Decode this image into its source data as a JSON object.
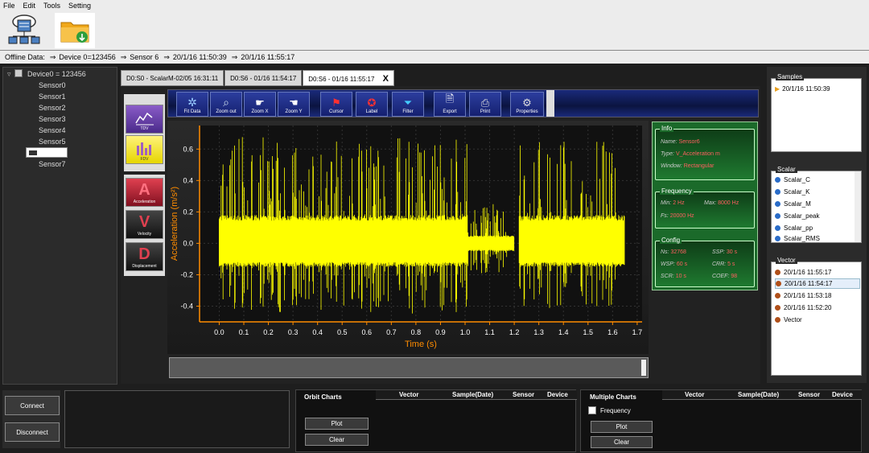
{
  "menu": [
    "File",
    "Edit",
    "Tools",
    "Setting"
  ],
  "info_bar": {
    "label": "Offline Data:",
    "device": "Device 0=123456",
    "sensor": "Sensor 6",
    "start": "20/1/16 11:50:39",
    "end": "20/1/16 11:55:17",
    "arrow": "⇒"
  },
  "tree": {
    "root": "Device0 = 123456",
    "sensors": [
      "Sensor0",
      "Sensor1",
      "Sensor2",
      "Sensor3",
      "Sensor4",
      "Sensor5",
      "",
      "Sensor7"
    ]
  },
  "tabs": [
    {
      "label": "D0:S0 - ScalarM-02/05 16:31:11"
    },
    {
      "label": "D0:S6 - 01/16 11:54:17"
    },
    {
      "label": "D0:S6 - 01/16 11:55:17",
      "close": "X"
    }
  ],
  "left_tools": [
    "TDV",
    "FDV",
    "Acceleration",
    "Velocity",
    "Displacement"
  ],
  "left_tools_glyphs": {
    "a": "A",
    "v": "V",
    "d": "D"
  },
  "toolbar": [
    "Fit Data",
    "Zoom out",
    "Zoom X",
    "Zoom Y",
    "Cursor",
    "Label",
    "Filter",
    "Export",
    "Print",
    "Properties"
  ],
  "info": {
    "title": "Info",
    "name_k": "Name:",
    "name_v": "Sensor6",
    "type_k": "Type:",
    "type_v": "V_Acceleration m",
    "window_k": "Window:",
    "window_v": "Rectangular"
  },
  "frequency": {
    "title": "Frequency",
    "min_k": "Min:",
    "min_v": "2 Hz",
    "max_k": "Max:",
    "max_v": "8000 Hz",
    "fs_k": "Fs:",
    "fs_v": "20000 Hz"
  },
  "config": {
    "title": "Config",
    "ns_k": "Ns:",
    "ns_v": "32768",
    "ssp_k": "SSP:",
    "ssp_v": "30 s",
    "wsp_k": "WSP:",
    "wsp_v": "60 s",
    "crr_k": "CRR:",
    "crr_v": "5 s",
    "scr_k": "SCR:",
    "scr_v": "10 s",
    "coef_k": "COEF:",
    "coef_v": "98"
  },
  "samples": {
    "title": "Samples",
    "items": [
      "20/1/16 11:50:39"
    ]
  },
  "scalar": {
    "title": "Scalar",
    "items": [
      "Scalar_C",
      "Scalar_K",
      "Scalar_M",
      "Scalar_peak",
      "Scalar_pp",
      "Scalar_RMS"
    ]
  },
  "vector": {
    "title": "Vector",
    "items": [
      "20/1/16 11:55:17",
      "20/1/16 11:54:17",
      "20/1/16 11:53:18",
      "20/1/16 11:52:20",
      "Vector"
    ]
  },
  "bottom": {
    "connect": "Connect",
    "disconnect": "Disconnect",
    "orbit_title": "Orbit Charts",
    "orbit_cols": [
      "Vector",
      "Sample(Date)",
      "Sensor",
      "Device"
    ],
    "orbit_plot": "Plot",
    "orbit_clear": "Clear",
    "multi_title": "Multiple Charts",
    "multi_cols": [
      "Vector",
      "Sample(Date)",
      "Sensor",
      "Device"
    ],
    "frequency": "Frequency",
    "multi_plot": "Plot",
    "multi_clear": "Clear"
  },
  "colors": {
    "signal": "#ffff00",
    "axis": "#ff8c00",
    "green_panel": "#1b6a2a",
    "toolbar": "#152070"
  },
  "chart_data": {
    "type": "line",
    "xlabel": "Time (s)",
    "ylabel": "Acceleration (m/s²)",
    "xlim": [
      -0.08,
      1.72
    ],
    "ylim": [
      -0.5,
      0.75
    ],
    "xticks": [
      "0.0",
      "0.1",
      "0.2",
      "0.3",
      "0.4",
      "0.5",
      "0.6",
      "0.7",
      "0.8",
      "0.9",
      "1.0",
      "1.1",
      "1.2",
      "1.3",
      "1.4",
      "1.5",
      "1.6",
      "1.7"
    ],
    "yticks": [
      "0.6",
      "0.4",
      "0.2",
      "0.0",
      "-0.2",
      "-0.4"
    ],
    "series": [
      {
        "color": "#ffff00",
        "envelope": [
          {
            "x_start": 0.0,
            "x_end": 1.01,
            "core_min": -0.15,
            "core_max": 0.18,
            "peak_min": -0.45,
            "peak_max": 0.68
          },
          {
            "x_start": 1.01,
            "x_end": 1.2,
            "core_min": -0.05,
            "core_max": 0.05,
            "peak_min": -0.2,
            "peak_max": 0.25
          },
          {
            "x_start": 1.22,
            "x_end": 1.65,
            "core_min": -0.15,
            "core_max": 0.18,
            "peak_min": -0.42,
            "peak_max": 0.65
          }
        ]
      }
    ],
    "grid": true
  }
}
